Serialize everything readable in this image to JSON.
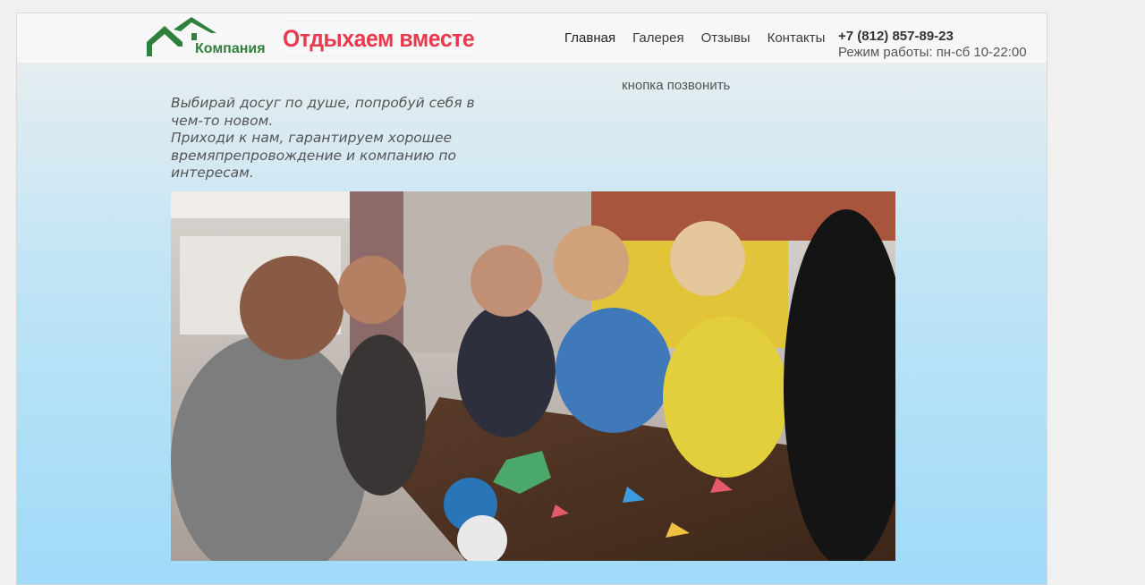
{
  "header": {
    "logo_text": "Компания",
    "brand_title": "Отдыхаем вместе",
    "nav": [
      {
        "label": "Главная"
      },
      {
        "label": "Галерея"
      },
      {
        "label": "Отзывы"
      },
      {
        "label": "Контакты"
      }
    ],
    "phone": "+7 (812) 857-89-23",
    "hours": "Режим работы: пн-сб 10-22:00"
  },
  "main": {
    "call_button": "кнопка позвонить",
    "tagline_line1": "Выбирай досуг по душе, попробуй себя в чем-то новом.",
    "tagline_line2": "Приходи к нам, гарантируем хорошее времяпрепровождение и компанию по интересам.",
    "hero_image": "friends-playing-board-game-photo"
  },
  "colors": {
    "brand_green": "#2f7f3d",
    "brand_red": "#e83a4f"
  }
}
